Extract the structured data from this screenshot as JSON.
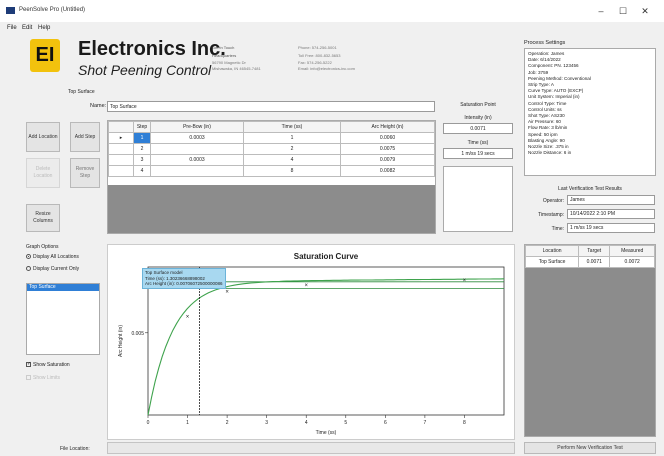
{
  "window": {
    "title": "PeenSolve Pro (Untitled)",
    "controls": {
      "minimize": "–",
      "maximize": "☐",
      "close": "✕"
    }
  },
  "menu": [
    "File",
    "Edit",
    "Help"
  ],
  "company": {
    "logo_text": "EI",
    "name": "Electronics Inc.",
    "tagline": "Shot Peening Control",
    "about_label": "Get in Touch",
    "address_label": "Headquarters",
    "address1": "56790 Magnetic Dr",
    "address2": "Mishawaka, IN 46545-7481",
    "phone": "Phone: 574-256-5001",
    "tollfree": "Toll Free: 800-832-5653",
    "fax": "Fax: 574-256-5222",
    "email": "Email: info@electronics-inc.com"
  },
  "curve_label": "Top Surface",
  "name_label": "Name:",
  "name_value": "Top Surface",
  "buttons": {
    "add_location": "Add Location",
    "add_step": "Add Step",
    "delete_location": "Delete Location",
    "remove_step": "Remove Step",
    "resize_columns": "Resize Columns",
    "perform_verification": "Perform New Verification Test"
  },
  "table": {
    "headers": [
      "Step",
      "Pre-Bow (in)",
      "Time (ss)",
      "Arc Height (in)"
    ],
    "rows": [
      {
        "marker": "▸",
        "step": "1",
        "prebow": "0.0003",
        "time": "1",
        "arc": "0.0060"
      },
      {
        "marker": "",
        "step": "2",
        "prebow": "",
        "time": "2",
        "arc": "0.0075"
      },
      {
        "marker": "",
        "step": "3",
        "prebow": "0.0003",
        "time": "4",
        "arc": "0.0079"
      },
      {
        "marker": "",
        "step": "4",
        "prebow": "",
        "time": "8",
        "arc": "0.0082"
      }
    ]
  },
  "saturation": {
    "title": "Saturation Point",
    "intensity_label": "Intensity (in)",
    "intensity_value": "0.0071",
    "time_label": "Time (ss)",
    "time_value": "1 m/ss 19 secs"
  },
  "process_settings": {
    "title": "Process Settings",
    "lines": [
      "Operation: James",
      "Date: 6/14/2022",
      "Component: PN. 123456",
      "Job: 3759",
      "Peening Method: Conventional",
      "Strip Type: A",
      "Curve Type: AUTO (EXCP)",
      "Unit System: Imperial (in)",
      "Control Type: Time",
      "Control Units: ss",
      "Shot Type: AS230",
      "Air Pressure: 60",
      "Flow Rate: 3 lb/min",
      "Speed: 50 ipm",
      "Blasting Angle: 90",
      "Nozzle Size: .375 in",
      "Nozzle Distance: 6 in"
    ]
  },
  "verification": {
    "title": "Last Verification Test Results",
    "operator_label": "Operator:",
    "operator_value": "James",
    "timestamp_label": "Timestamp:",
    "timestamp_value": "10/14/2022 2:10 PM",
    "time_label": "Time:",
    "time_value": "1 m/ss 19 secs",
    "results_headers": [
      "Location",
      "Target",
      "Measured"
    ],
    "results_rows": [
      {
        "location": "Top Surface",
        "target": "0.0071",
        "measured": "0.0072"
      }
    ]
  },
  "graph_options": {
    "title": "Graph Options",
    "option_all": "Display All Locations",
    "option_current": "Display Current Only",
    "list_items": [
      "Top Surface"
    ],
    "show_saturation": "Show Saturation",
    "show_limits": "Show Limits"
  },
  "chart_data": {
    "type": "line",
    "title": "Saturation Curve",
    "xlabel": "Time (ss)",
    "ylabel": "Arc Height (in)",
    "xlim": [
      0,
      9
    ],
    "x_ticks": [
      "0",
      "1",
      "2",
      "3",
      "4",
      "5",
      "6",
      "7",
      "8"
    ],
    "y_ticks": [
      "0.005"
    ],
    "points": [
      {
        "x": 1,
        "y": 0.006
      },
      {
        "x": 2,
        "y": 0.0075
      },
      {
        "x": 4,
        "y": 0.0079
      },
      {
        "x": 8,
        "y": 0.0082
      }
    ],
    "tooltip": {
      "line1": "Top Surface model",
      "line2": "Time (ss): 1.30236668898002",
      "line3": "Arc Height (in): 0.00706072500000086"
    },
    "colors": {
      "curve": "#3fa34d",
      "band": "#2a8a3a"
    }
  },
  "file_location_label": "File Location:",
  "colors": {
    "logo": "#f2c20d",
    "selection": "#2f7fd6"
  }
}
